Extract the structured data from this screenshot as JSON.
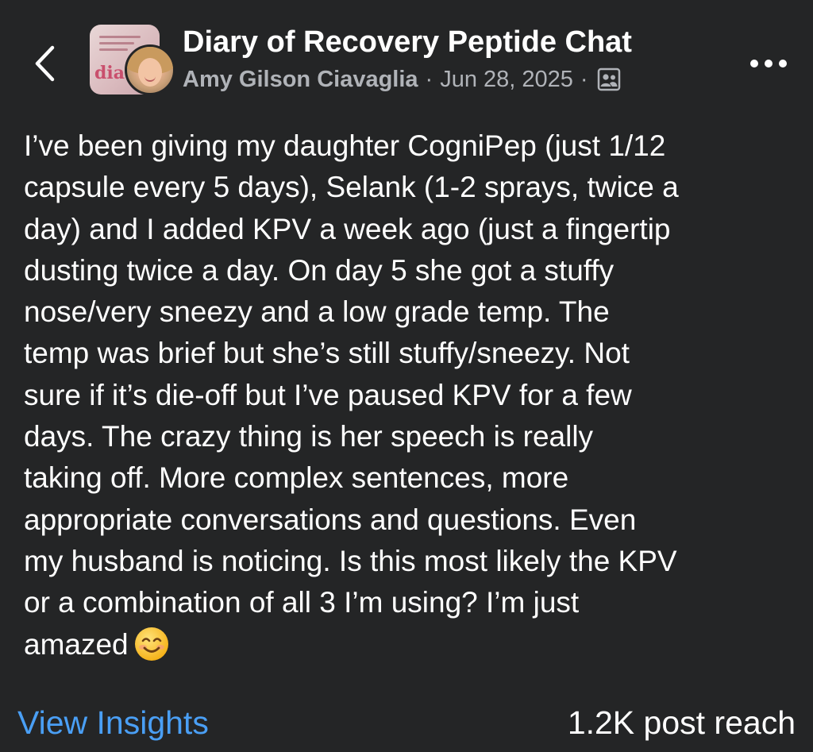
{
  "header": {
    "title": "Diary of Recovery Peptide Chat",
    "author": "Amy Gilson Ciavaglia",
    "date": "Jun 28, 2025",
    "separator": "·",
    "group_avatar_text": "dia",
    "icons": {
      "back": "chevron-left-icon",
      "more": "more-horizontal-icon",
      "audience": "members-icon"
    }
  },
  "post": {
    "body": "I’ve been giving my daughter CogniPep (just 1/12\ncapsule every 5 days), Selank (1-2 sprays, twice a\nday) and I added KPV a week ago (just a fingertip\ndusting twice a day.  On day 5 she got a stuffy\nnose/very sneezy and a low grade temp.  The\ntemp was brief but she’s still stuffy/sneezy.  Not\nsure if it’s die-off but I’ve paused KPV for a few\ndays.  The crazy thing is her speech is really\ntaking off.  More complex sentences, more\nappropriate conversations and questions.  Even\nmy husband is noticing.  Is this most likely the KPV\nor a combination of all 3 I’m using?  I’m just\namazed",
    "emoji": "smiling-face-emoji"
  },
  "footer": {
    "insights_label": "View Insights",
    "reach_label": "1.2K post reach"
  },
  "colors": {
    "background": "#242526",
    "text": "#ffffff",
    "secondary_text": "#b0b3b8",
    "link": "#4a9ff5"
  }
}
